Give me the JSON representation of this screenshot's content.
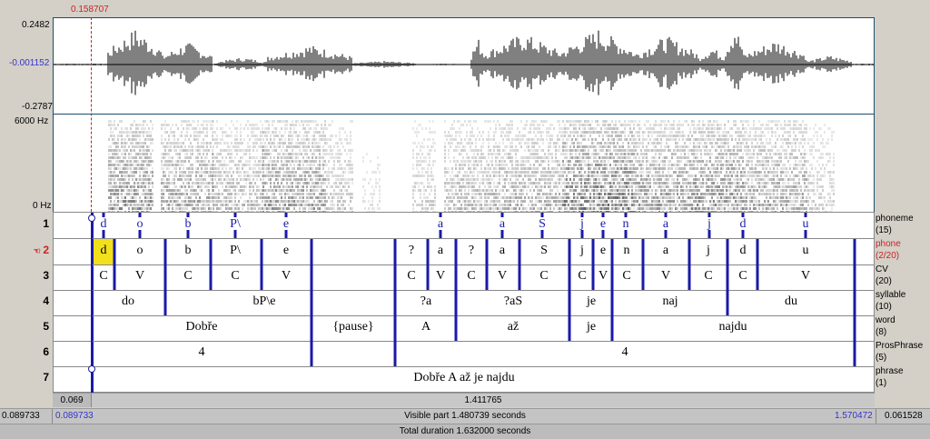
{
  "cursor_time": "0.158707",
  "waveform": {
    "max": "0.2482",
    "mid": "-0.001152",
    "min": "-0.2787"
  },
  "spectrogram": {
    "top": "6000 Hz",
    "bottom": "0 Hz"
  },
  "tiers": [
    {
      "num": "1",
      "name": "phoneme",
      "count": "(15)",
      "marks": [
        "d",
        "o",
        "b",
        "P\\",
        "e",
        "a",
        "a",
        "S",
        "j",
        "e",
        "n",
        "a",
        "j",
        "d",
        "u"
      ]
    },
    {
      "num": "2",
      "name": "phone",
      "count": "(2/20)",
      "labels": [
        "d",
        "o",
        "b",
        "P\\",
        "e",
        "?",
        "a",
        "?",
        "a",
        "S",
        "j",
        "e",
        "n",
        "a",
        "j",
        "d",
        "u"
      ]
    },
    {
      "num": "3",
      "name": "CV",
      "count": "(20)",
      "labels": [
        "C",
        "V",
        "C",
        "C",
        "V",
        "C",
        "V",
        "C",
        "V",
        "C",
        "C",
        "V",
        "C",
        "V",
        "C",
        "C",
        "V"
      ]
    },
    {
      "num": "4",
      "name": "syllable",
      "count": "(10)",
      "labels": [
        "do",
        "bP\\e",
        "?a",
        "?aS",
        "je",
        "naj",
        "du"
      ]
    },
    {
      "num": "5",
      "name": "word",
      "count": "(8)",
      "labels": [
        "Dobře",
        "{pause}",
        "A",
        "až",
        "je",
        "najdu"
      ]
    },
    {
      "num": "6",
      "name": "ProsPhrase",
      "count": "(5)",
      "labels": [
        "4",
        "4"
      ]
    },
    {
      "num": "7",
      "name": "phrase",
      "count": "(1)",
      "labels": [
        "Dobře A až je najdu"
      ]
    }
  ],
  "selection_left": "0.069",
  "selection_len": "1.411765",
  "bottom": {
    "left_total": "0.089733",
    "left_visible": "0.089733",
    "visible": "Visible part 1.480739 seconds",
    "right_visible": "1.570472",
    "right_total": "0.061528",
    "total": "Total duration 1.632000 seconds"
  },
  "colors": {
    "boundary": "#1a1aa8",
    "selected": "#f2e01a",
    "axis": "#1a4f6e"
  }
}
